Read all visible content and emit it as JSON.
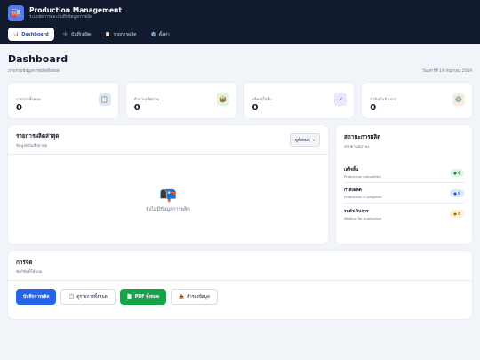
{
  "app": {
    "title": "Production Management",
    "subtitle": "ระบบจัดการและบันทึกข้อมูลการผลิต",
    "logo_icon": "factory-icon"
  },
  "nav": [
    {
      "label": "Dashboard",
      "icon": "📊",
      "icon_name": "chart-icon",
      "active": true
    },
    {
      "label": "บันทึกผลิต",
      "icon": "➕",
      "icon_name": "plus-icon",
      "active": false
    },
    {
      "label": "รายการผลิต",
      "icon": "📋",
      "icon_name": "clipboard-icon",
      "active": false
    },
    {
      "label": "ตั้งค่า",
      "icon": "⚙️",
      "icon_name": "gear-icon",
      "active": false
    }
  ],
  "page": {
    "title": "Dashboard",
    "subtitle": "ภาพรวมข้อมูลการผลิตทั้งหมด",
    "date": "วันเสาร์ที่ 19 กันยายน 2569"
  },
  "stats": [
    {
      "label": "รายการทั้งหมด",
      "value": "0",
      "icon": "📋",
      "icon_name": "clipboard-icon",
      "color": "#dbe7fb"
    },
    {
      "label": "จำนวนผลิตรวม",
      "value": "0",
      "icon": "📦",
      "icon_name": "package-icon",
      "color": "#dcf5e3"
    },
    {
      "label": "ผลิตเสร็จสิ้น",
      "value": "0",
      "icon": "✓",
      "icon_name": "check-icon",
      "color": "#ebe7fb"
    },
    {
      "label": "กำลังดำเนินการ",
      "value": "0",
      "icon": "⚙️",
      "icon_name": "gear-icon",
      "color": "#fcecd8"
    }
  ],
  "recent": {
    "title": "รายการผลิตล่าสุด",
    "subtitle": "ข้อมูลที่บันทึกล่าสุด",
    "view_all": "ดูทั้งหมด →",
    "empty_icon": "📭",
    "empty_text": "ยังไม่มีข้อมูลการผลิต"
  },
  "status": {
    "title": "สถานะการผลิต",
    "subtitle": "สรุปตามสถานะ",
    "items": [
      {
        "name": "เสร็จสิ้น",
        "desc": "Production completed",
        "count": "● 0",
        "bg": "#dcf5e3",
        "fg": "#15803d"
      },
      {
        "name": "กำลังผลิต",
        "desc": "Production in progress",
        "count": "● 0",
        "bg": "#dbe7fb",
        "fg": "#1d4ed8"
      },
      {
        "name": "รอดำเนินการ",
        "desc": "Waiting for production",
        "count": "● 0",
        "bg": "#fdf1cf",
        "fg": "#a16207"
      }
    ]
  },
  "exports": {
    "title": "การจัด",
    "subtitle": "ฟังก์ชันที่ใช้บ่อย",
    "buttons": [
      {
        "label": "บันทึกการผลิต",
        "icon": "",
        "style": "primary"
      },
      {
        "label": "ดูรายการทั้งหมด",
        "icon": "📋",
        "icon_name": "clipboard-icon",
        "style": "light"
      },
      {
        "label": "PDF ทั้งหมด",
        "icon": "📄",
        "icon_name": "document-icon",
        "style": "green"
      },
      {
        "label": "สำรองข้อมูล",
        "icon": "📤",
        "icon_name": "export-icon",
        "style": "light"
      }
    ]
  }
}
